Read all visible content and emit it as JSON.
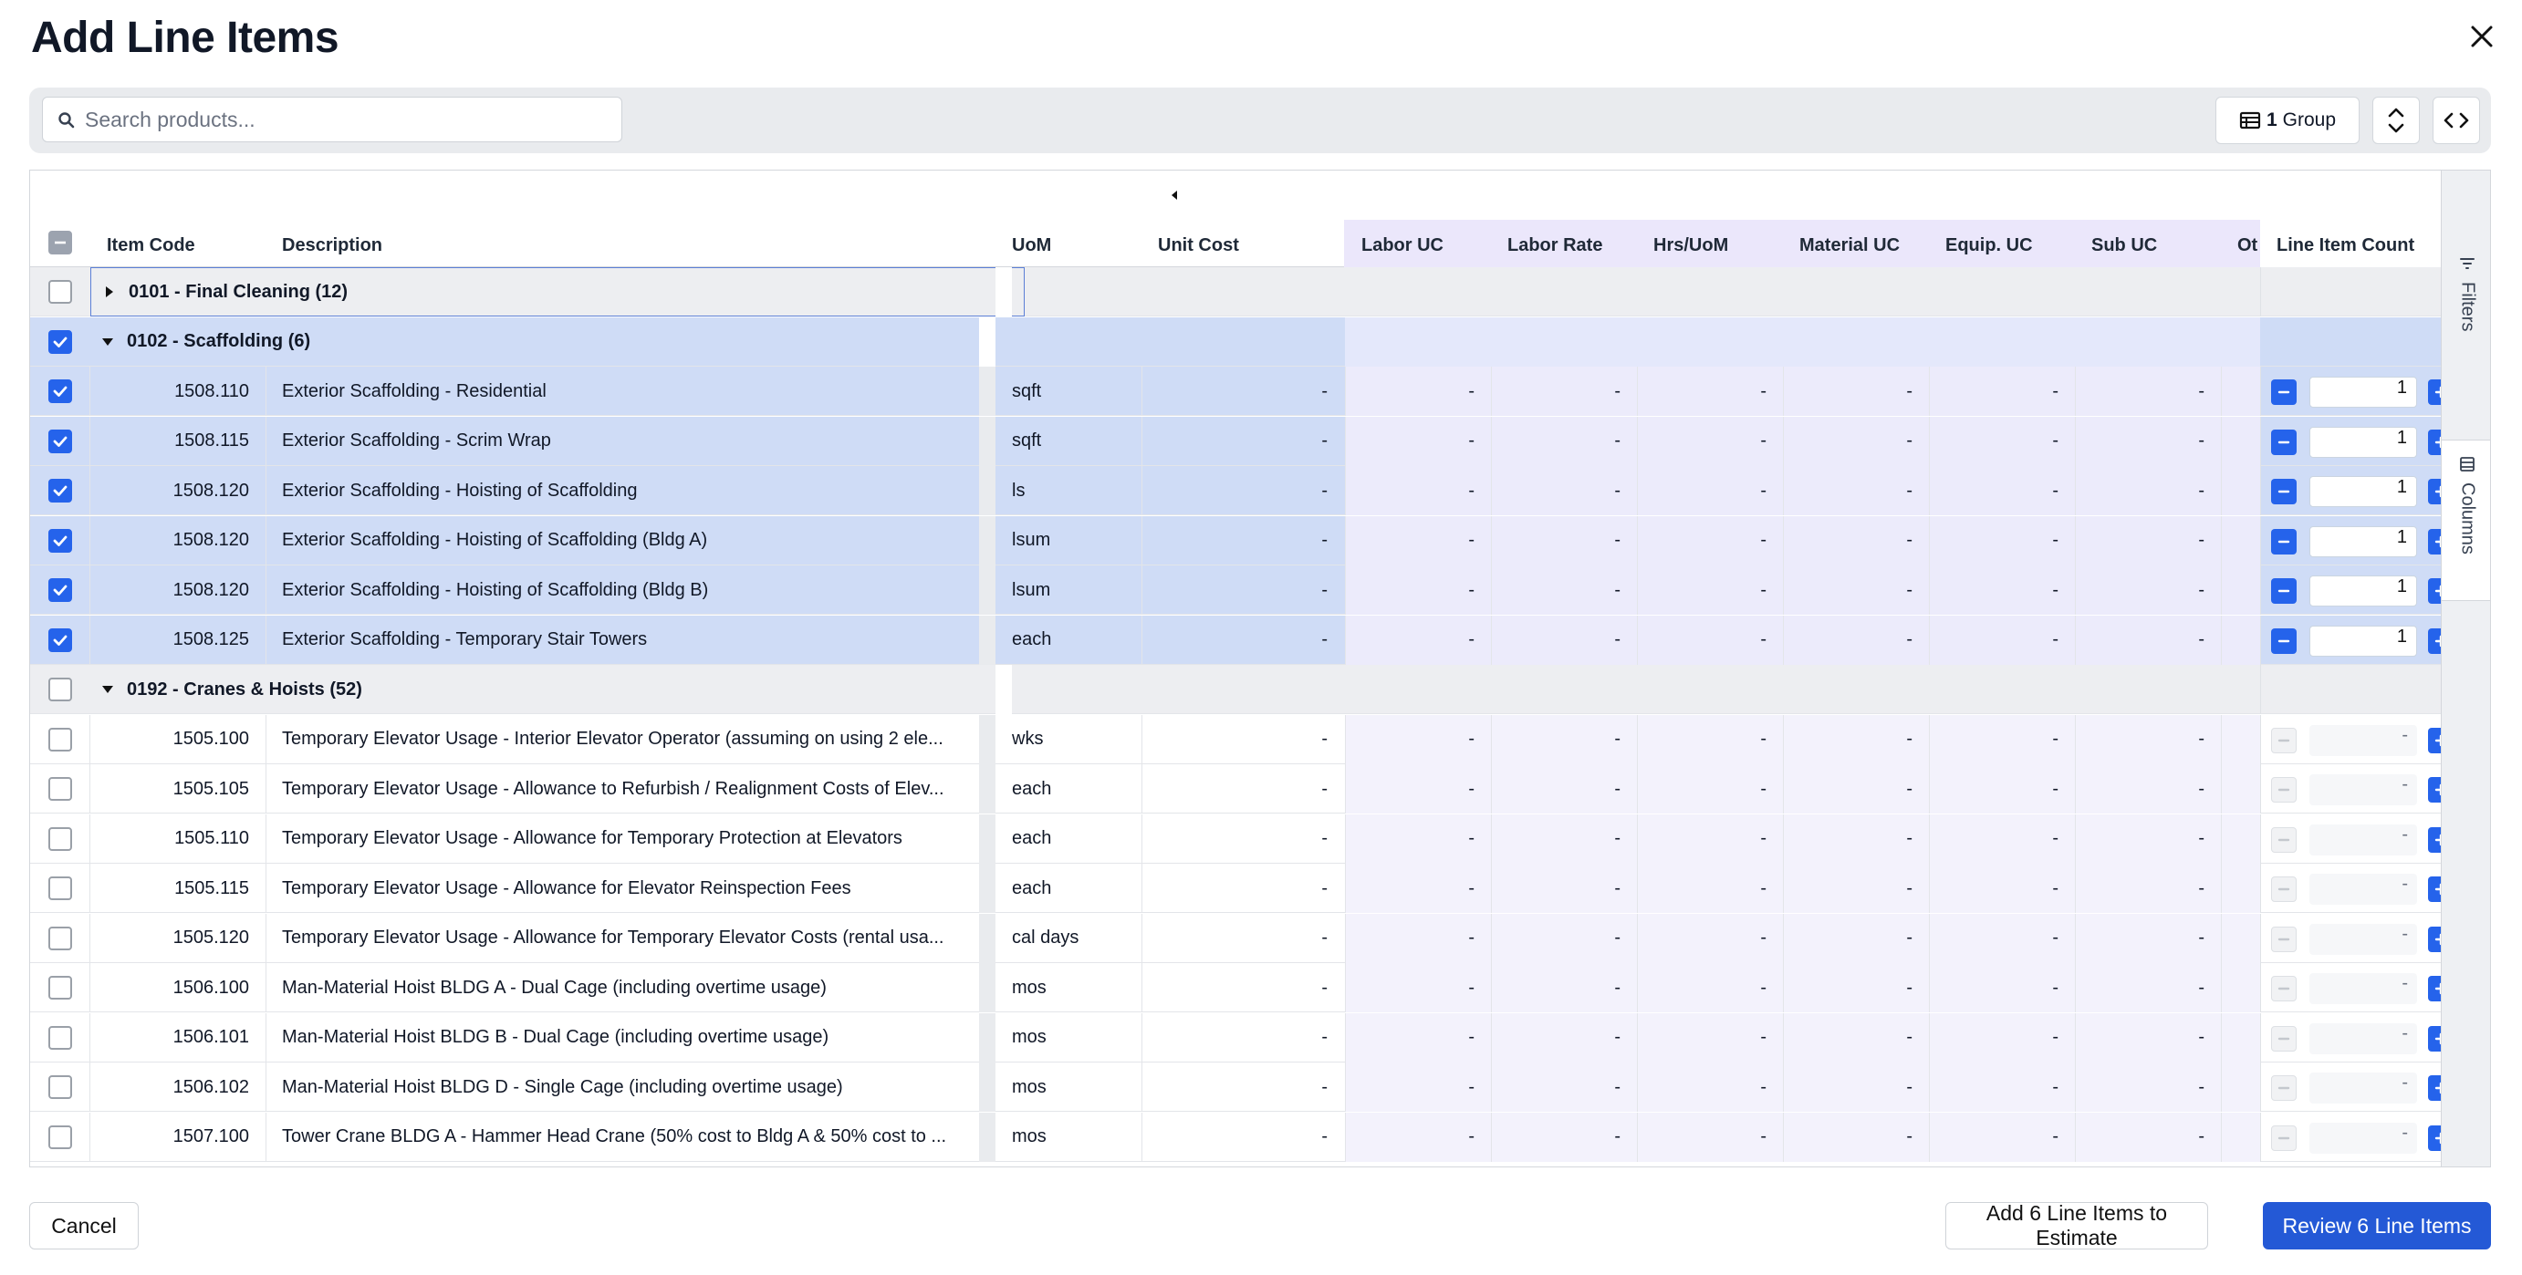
{
  "dialog": {
    "title": "Add Line Items"
  },
  "toolbar": {
    "search_placeholder": "Search products...",
    "group_count": "1",
    "group_label": "Group"
  },
  "columns": {
    "item_code": "Item Code",
    "description": "Description",
    "uom": "UoM",
    "unit_cost": "Unit Cost",
    "labor_uc": "Labor UC",
    "labor_rate": "Labor Rate",
    "hrs_uom": "Hrs/UoM",
    "material_uc": "Material UC",
    "equip_uc": "Equip. UC",
    "sub_uc": "Sub UC",
    "other_uc": "Ot",
    "line_item_count": "Line Item Count"
  },
  "side_panel": {
    "filters": "Filters",
    "columns": "Columns"
  },
  "groups": [
    {
      "label": "0101 - Final Cleaning (12)",
      "expanded": false,
      "checked": false
    },
    {
      "label": "0102 - Scaffolding (6)",
      "expanded": true,
      "checked": true
    },
    {
      "label": "0192 - Cranes & Hoists (52)",
      "expanded": true,
      "checked": false
    }
  ],
  "rows": [
    {
      "code": "1508.110",
      "description": "Exterior Scaffolding - Residential",
      "uom": "sqft",
      "unit_cost": "-",
      "labor_uc": "-",
      "labor_rate": "-",
      "hrs_uom": "-",
      "material_uc": "-",
      "equip_uc": "-",
      "sub_uc": "-",
      "count": "1",
      "selected": true
    },
    {
      "code": "1508.115",
      "description": "Exterior Scaffolding - Scrim Wrap",
      "uom": "sqft",
      "unit_cost": "-",
      "labor_uc": "-",
      "labor_rate": "-",
      "hrs_uom": "-",
      "material_uc": "-",
      "equip_uc": "-",
      "sub_uc": "-",
      "count": "1",
      "selected": true
    },
    {
      "code": "1508.120",
      "description": "Exterior Scaffolding - Hoisting of Scaffolding",
      "uom": "ls",
      "unit_cost": "-",
      "labor_uc": "-",
      "labor_rate": "-",
      "hrs_uom": "-",
      "material_uc": "-",
      "equip_uc": "-",
      "sub_uc": "-",
      "count": "1",
      "selected": true
    },
    {
      "code": "1508.120",
      "description": "Exterior Scaffolding - Hoisting of Scaffolding (Bldg A)",
      "uom": "lsum",
      "unit_cost": "-",
      "labor_uc": "-",
      "labor_rate": "-",
      "hrs_uom": "-",
      "material_uc": "-",
      "equip_uc": "-",
      "sub_uc": "-",
      "count": "1",
      "selected": true
    },
    {
      "code": "1508.120",
      "description": "Exterior Scaffolding - Hoisting of Scaffolding (Bldg B)",
      "uom": "lsum",
      "unit_cost": "-",
      "labor_uc": "-",
      "labor_rate": "-",
      "hrs_uom": "-",
      "material_uc": "-",
      "equip_uc": "-",
      "sub_uc": "-",
      "count": "1",
      "selected": true
    },
    {
      "code": "1508.125",
      "description": "Exterior Scaffolding - Temporary Stair Towers",
      "uom": "each",
      "unit_cost": "-",
      "labor_uc": "-",
      "labor_rate": "-",
      "hrs_uom": "-",
      "material_uc": "-",
      "equip_uc": "-",
      "sub_uc": "-",
      "count": "1",
      "selected": true
    },
    {
      "code": "1505.100",
      "description": "Temporary Elevator Usage - Interior Elevator Operator (assuming on using 2 ele...",
      "uom": "wks",
      "unit_cost": "-",
      "labor_uc": "-",
      "labor_rate": "-",
      "hrs_uom": "-",
      "material_uc": "-",
      "equip_uc": "-",
      "sub_uc": "-",
      "count": "-",
      "selected": false
    },
    {
      "code": "1505.105",
      "description": "Temporary Elevator Usage - Allowance to Refurbish / Realignment Costs of Elev...",
      "uom": "each",
      "unit_cost": "-",
      "labor_uc": "-",
      "labor_rate": "-",
      "hrs_uom": "-",
      "material_uc": "-",
      "equip_uc": "-",
      "sub_uc": "-",
      "count": "-",
      "selected": false
    },
    {
      "code": "1505.110",
      "description": "Temporary Elevator Usage - Allowance for Temporary Protection at Elevators",
      "uom": "each",
      "unit_cost": "-",
      "labor_uc": "-",
      "labor_rate": "-",
      "hrs_uom": "-",
      "material_uc": "-",
      "equip_uc": "-",
      "sub_uc": "-",
      "count": "-",
      "selected": false
    },
    {
      "code": "1505.115",
      "description": "Temporary Elevator Usage - Allowance for Elevator Reinspection Fees",
      "uom": "each",
      "unit_cost": "-",
      "labor_uc": "-",
      "labor_rate": "-",
      "hrs_uom": "-",
      "material_uc": "-",
      "equip_uc": "-",
      "sub_uc": "-",
      "count": "-",
      "selected": false
    },
    {
      "code": "1505.120",
      "description": "Temporary Elevator Usage - Allowance for Temporary Elevator Costs (rental usa...",
      "uom": "cal days",
      "unit_cost": "-",
      "labor_uc": "-",
      "labor_rate": "-",
      "hrs_uom": "-",
      "material_uc": "-",
      "equip_uc": "-",
      "sub_uc": "-",
      "count": "-",
      "selected": false
    },
    {
      "code": "1506.100",
      "description": "Man-Material Hoist BLDG A - Dual Cage (including overtime usage)",
      "uom": "mos",
      "unit_cost": "-",
      "labor_uc": "-",
      "labor_rate": "-",
      "hrs_uom": "-",
      "material_uc": "-",
      "equip_uc": "-",
      "sub_uc": "-",
      "count": "-",
      "selected": false
    },
    {
      "code": "1506.101",
      "description": "Man-Material Hoist BLDG B - Dual Cage (including overtime usage)",
      "uom": "mos",
      "unit_cost": "-",
      "labor_uc": "-",
      "labor_rate": "-",
      "hrs_uom": "-",
      "material_uc": "-",
      "equip_uc": "-",
      "sub_uc": "-",
      "count": "-",
      "selected": false
    },
    {
      "code": "1506.102",
      "description": "Man-Material Hoist BLDG D - Single Cage (including overtime usage)",
      "uom": "mos",
      "unit_cost": "-",
      "labor_uc": "-",
      "labor_rate": "-",
      "hrs_uom": "-",
      "material_uc": "-",
      "equip_uc": "-",
      "sub_uc": "-",
      "count": "-",
      "selected": false
    },
    {
      "code": "1507.100",
      "description": "Tower Crane BLDG A - Hammer Head Crane (50% cost to Bldg A & 50% cost to ...",
      "uom": "mos",
      "unit_cost": "-",
      "labor_uc": "-",
      "labor_rate": "-",
      "hrs_uom": "-",
      "material_uc": "-",
      "equip_uc": "-",
      "sub_uc": "-",
      "count": "-",
      "selected": false
    }
  ],
  "footer": {
    "cancel_label": "Cancel",
    "add_label": "Add 6 Line Items to Estimate",
    "review_label": "Review 6 Line Items"
  },
  "colors": {
    "accent": "#2563eb",
    "selected_row": "#cfdcf6",
    "group_row": "#edeef1",
    "purple_columns": "#ebe7fb"
  },
  "icons": {
    "close": "close-icon",
    "search": "search-icon",
    "group": "table-icon",
    "expand": "expand-vertical-icon",
    "code": "code-icon",
    "filters": "filter-icon",
    "columns": "columns-icon"
  }
}
